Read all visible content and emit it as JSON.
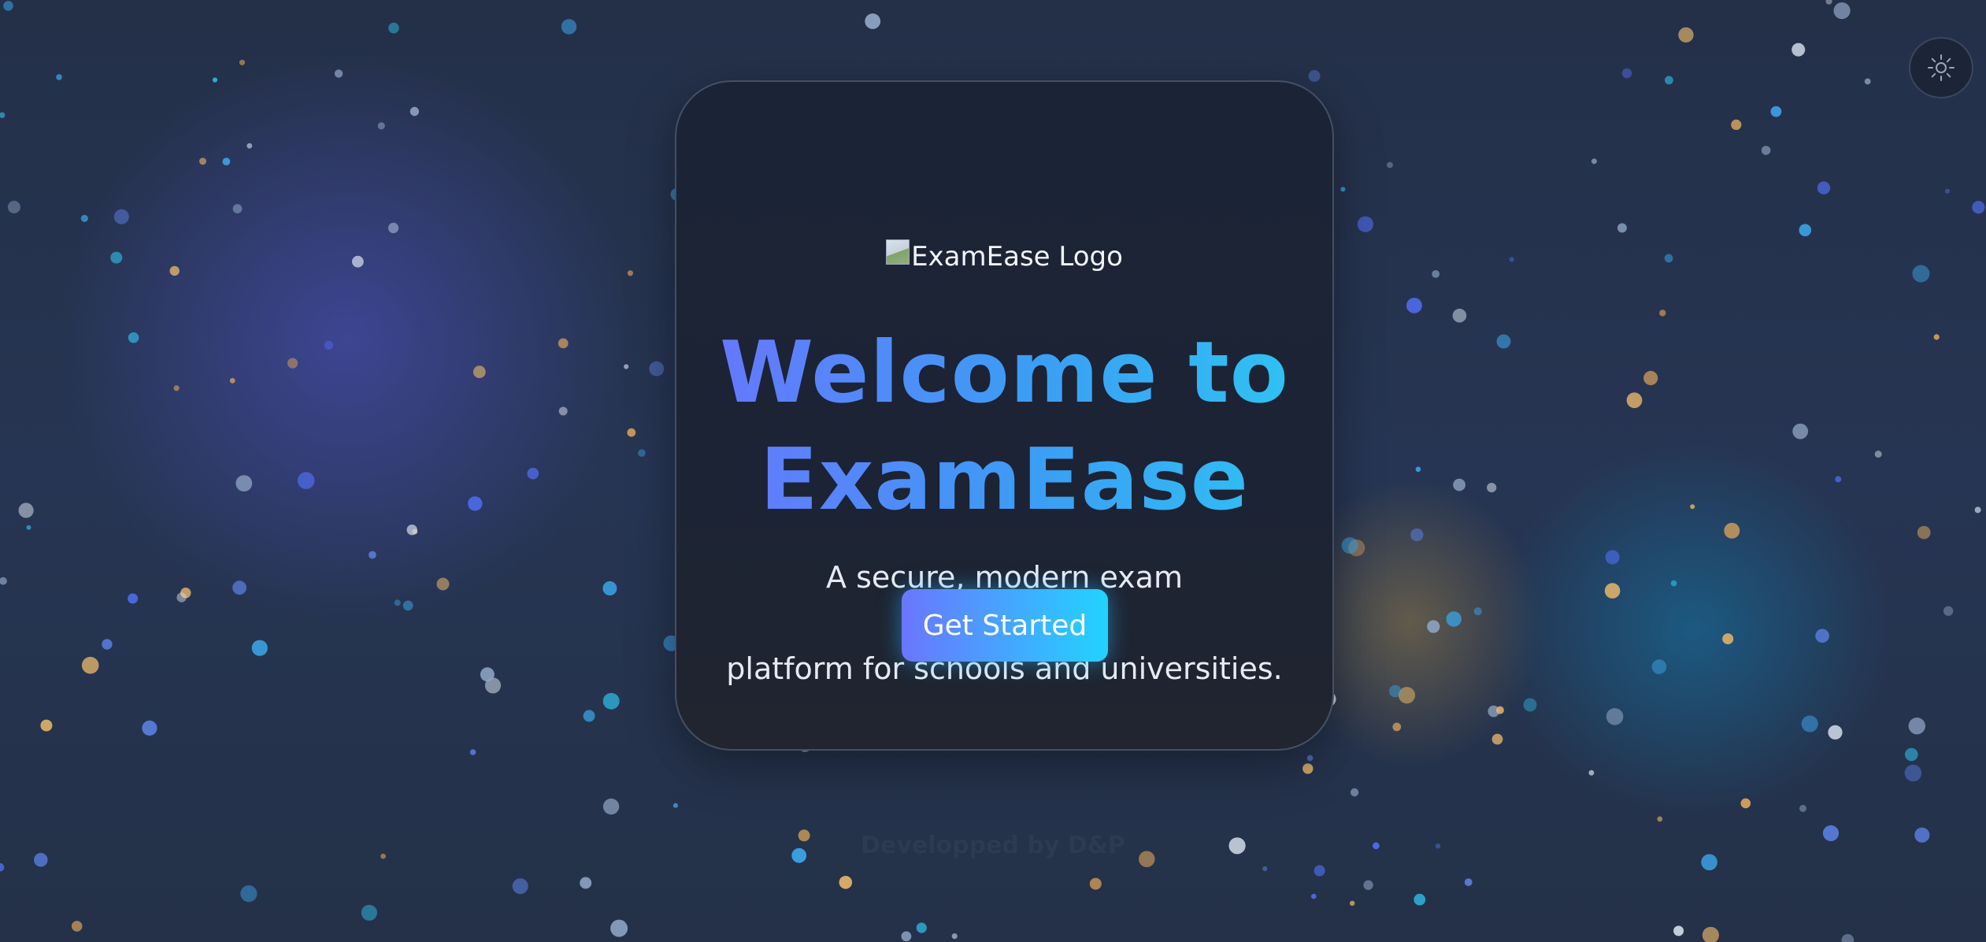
{
  "logo": {
    "alt_text": "ExamEase Logo"
  },
  "hero": {
    "title_line1": "Welcome to",
    "title_line2": "ExamEase",
    "subtitle_line1": "A secure, modern exam management",
    "subtitle_line2": "platform for schools and universities.",
    "cta_label": "Get Started"
  },
  "footer": {
    "credit": "Developped by D&P"
  },
  "header": {
    "theme_toggle_icon": "sun-icon"
  },
  "colors": {
    "background": "#233049",
    "card": "#1b2436",
    "gradient_start": "#6b73ff",
    "gradient_end": "#2ec7f2",
    "text": "#e6ebf3"
  }
}
